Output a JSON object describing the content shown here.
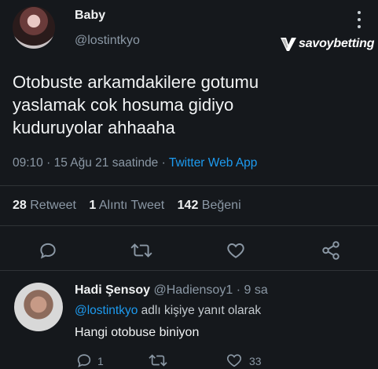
{
  "tweet": {
    "display_name": "Baby",
    "handle": "@lostintkyo",
    "text_lines": [
      "Otobuste arkamdakilere gotumu",
      "yaslamak cok hosuma gidiyo",
      "kuduruyolar ahhaaha"
    ],
    "time": "09:10",
    "date": "15 Ağu 21 saatinde",
    "source": "Twitter Web App",
    "more_icon": "more-vertical-icon"
  },
  "stats": {
    "retweets_count": "28",
    "retweets_label": "Retweet",
    "quotes_count": "1",
    "quotes_label": "Alıntı Tweet",
    "likes_count": "142",
    "likes_label": "Beğeni"
  },
  "watermark": {
    "text": "savoybetting"
  },
  "reply": {
    "display_name": "Hadi Şensoy",
    "handle": "@Hadiensoy1",
    "time": "9 sa",
    "replying_to_handle": "@lostintkyo",
    "replying_to_suffix": "adlı kişiye yanıt olarak",
    "text": "Hangi otobuse biniyon",
    "reply_count": "1",
    "like_count": "33"
  },
  "colors": {
    "background": "#15181c",
    "text_primary": "#e7e9ea",
    "text_secondary": "#8b98a5",
    "link": "#1d9bf0",
    "divider": "#2f3336"
  }
}
